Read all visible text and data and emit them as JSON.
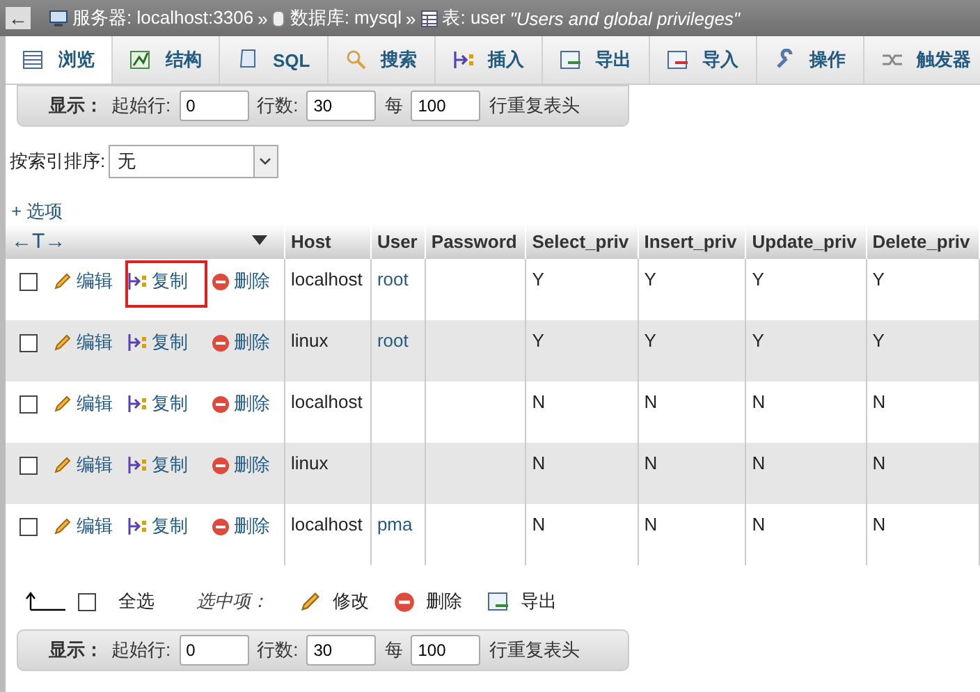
{
  "breadcrumb": {
    "back": "←",
    "server": "服务器: localhost:3306",
    "sep1": "»",
    "database": "数据库: mysql",
    "sep2": "»",
    "table": "表: user",
    "comment": "\"Users and global privileges\""
  },
  "tabs": [
    {
      "label": "浏览",
      "selected": true
    },
    {
      "label": "结构",
      "selected": false
    },
    {
      "label": "SQL",
      "selected": false
    },
    {
      "label": "搜索",
      "selected": false
    },
    {
      "label": "插入",
      "selected": false
    },
    {
      "label": "导出",
      "selected": false
    },
    {
      "label": "导入",
      "selected": false
    },
    {
      "label": "操作",
      "selected": false
    },
    {
      "label": "触发器",
      "selected": false
    }
  ],
  "nav_top": {
    "show": "显示：",
    "start_label": "起始行:",
    "start": "0",
    "rows_label": "行数:",
    "rows": "30",
    "every": "每",
    "repeat": "100",
    "repeat_label": "行重复表头"
  },
  "sort": {
    "label": "按索引排序:",
    "value": "无"
  },
  "options_link": "+ 选项",
  "table": {
    "arrows": "←T→",
    "columns": [
      "Host",
      "User",
      "Password",
      "Select_priv",
      "Insert_priv",
      "Update_priv",
      "Delete_priv"
    ],
    "rows": [
      {
        "checked": false,
        "highlighted": true,
        "actions": [
          "编辑",
          "复制",
          "删除"
        ],
        "cells": [
          "localhost",
          "root",
          "",
          "Y",
          "Y",
          "Y",
          "Y"
        ]
      },
      {
        "checked": false,
        "highlighted": false,
        "actions": [
          "编辑",
          "复制",
          "删除"
        ],
        "cells": [
          "linux",
          "root",
          "",
          "Y",
          "Y",
          "Y",
          "Y"
        ]
      },
      {
        "checked": false,
        "highlighted": false,
        "actions": [
          "编辑",
          "复制",
          "删除"
        ],
        "cells": [
          "localhost",
          "",
          "",
          "N",
          "N",
          "N",
          "N"
        ]
      },
      {
        "checked": false,
        "highlighted": false,
        "actions": [
          "编辑",
          "复制",
          "删除"
        ],
        "cells": [
          "linux",
          "",
          "",
          "N",
          "N",
          "N",
          "N"
        ]
      },
      {
        "checked": false,
        "highlighted": false,
        "actions": [
          "编辑",
          "复制",
          "删除"
        ],
        "cells": [
          "localhost",
          "pma",
          "",
          "N",
          "N",
          "N",
          "N"
        ]
      }
    ]
  },
  "bulk": {
    "select_all": "全选",
    "select_all_checked": false,
    "with_selected": "选中项：",
    "edit": "修改",
    "delete": "删除",
    "export": "导出"
  },
  "nav_bottom": {
    "show": "显示：",
    "start_label": "起始行:",
    "start": "0",
    "rows_label": "行数:",
    "rows": "30",
    "every": "每",
    "repeat": "100",
    "repeat_label": "行重复表头"
  }
}
